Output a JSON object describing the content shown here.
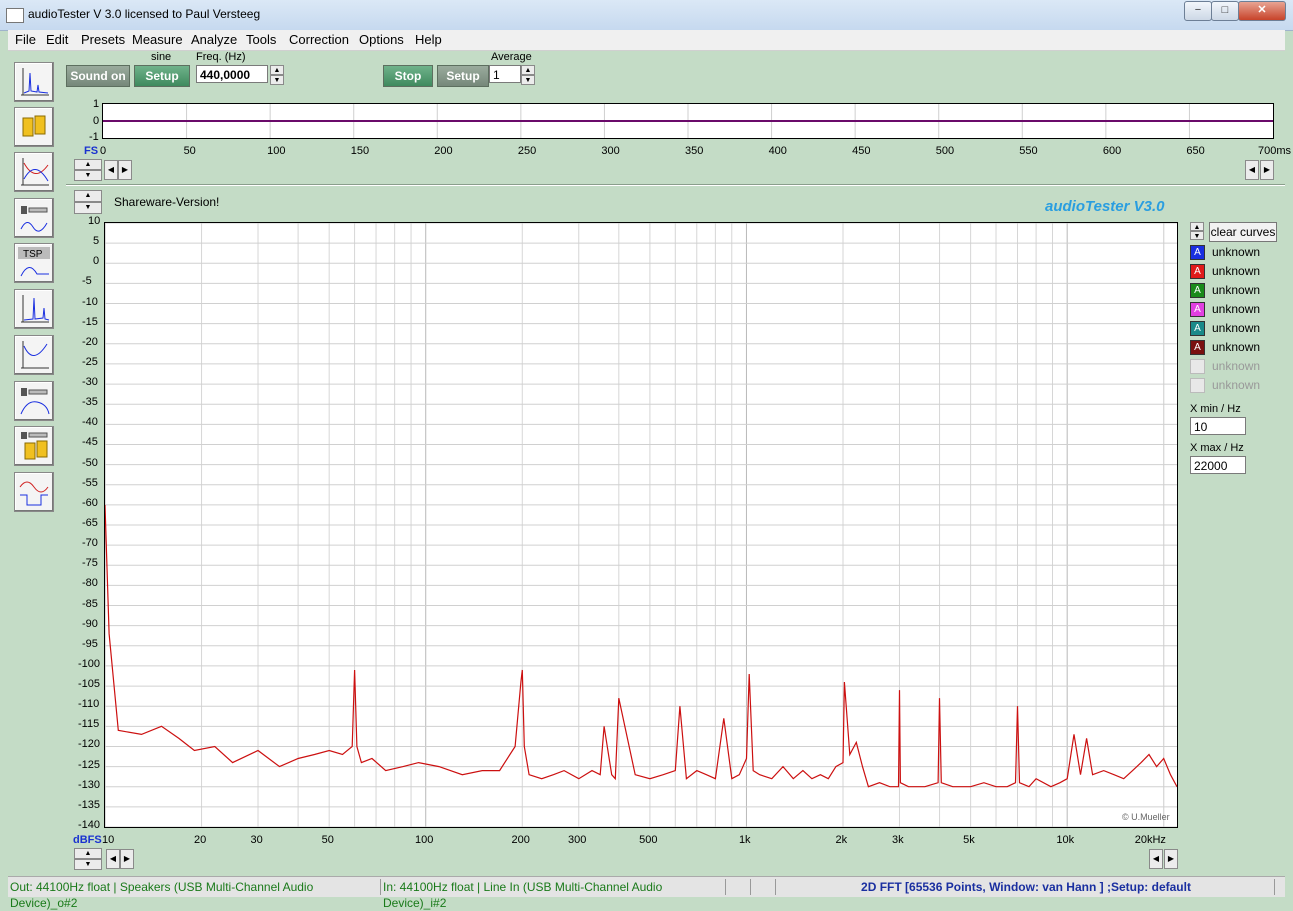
{
  "window": {
    "title": "audioTester  V 3.0   licensed to Paul Versteeg",
    "min": "−",
    "max": "□",
    "close": "✕"
  },
  "menu": [
    "File",
    "Edit",
    "Presets",
    "Measure",
    "Analyze",
    "Tools",
    "Correction",
    "Options",
    "Help"
  ],
  "generator": {
    "sound_on": "Sound on",
    "signal_type": "sine",
    "setup": "Setup",
    "freq_label": "Freq. (Hz)",
    "freq_value": "440,0000"
  },
  "capture": {
    "stop": "Stop",
    "setup": "Setup",
    "average_label": "Average",
    "average_value": "1"
  },
  "scope": {
    "y_ticks": [
      "1",
      "0",
      "-1"
    ],
    "fs_label": "FS",
    "x_ticks": [
      "0",
      "50",
      "100",
      "150",
      "200",
      "250",
      "300",
      "350",
      "400",
      "450",
      "500",
      "550",
      "600",
      "650",
      "700ms"
    ]
  },
  "shareware": "Shareware-Version!",
  "brand": "audioTester  V3.0",
  "copyright": "© U.Mueller",
  "spectrum": {
    "y_unit": "dBFS",
    "x_tick_labels": [
      "10",
      "20",
      "30",
      "50",
      "100",
      "200",
      "300",
      "500",
      "1k",
      "2k",
      "3k",
      "5k",
      "10k",
      "20kHz"
    ]
  },
  "legend": {
    "clear": "clear curves",
    "items": [
      {
        "label": "unknown",
        "color": "#1a2fe0",
        "active": true
      },
      {
        "label": "unknown",
        "color": "#e01a1a",
        "active": true
      },
      {
        "label": "unknown",
        "color": "#1a8a1a",
        "active": true
      },
      {
        "label": "unknown",
        "color": "#e040e0",
        "active": true
      },
      {
        "label": "unknown",
        "color": "#1a8a8a",
        "active": true
      },
      {
        "label": "unknown",
        "color": "#7a1010",
        "active": true
      },
      {
        "label": "unknown",
        "color": "#aaaaaa",
        "active": false
      },
      {
        "label": "unknown",
        "color": "#aaaaaa",
        "active": false
      }
    ],
    "xmin_label": "X min / Hz",
    "xmin_value": "10",
    "xmax_label": "X max / Hz",
    "xmax_value": "22000"
  },
  "status": {
    "out": "Out: 44100Hz float  | Speakers (USB Multi-Channel Audio Device)_o#2",
    "in": "In: 44100Hz float  | Line In (USB Multi-Channel Audio Device)_i#2",
    "info": "2D FFT [65536 Points, Window: van Hann ] ;Setup:  default"
  },
  "chart_data": {
    "type": "line",
    "title": "",
    "xlabel": "",
    "ylabel": "dBFS",
    "xscale": "log",
    "xlim": [
      10,
      22000
    ],
    "ylim": [
      -140,
      10
    ],
    "y_ticks": [
      10,
      5,
      0,
      -5,
      -10,
      -15,
      -20,
      -25,
      -30,
      -35,
      -40,
      -45,
      -50,
      -55,
      -60,
      -65,
      -70,
      -75,
      -80,
      -85,
      -90,
      -95,
      -100,
      -105,
      -110,
      -115,
      -120,
      -125,
      -130,
      -135,
      -140
    ],
    "grid": true,
    "series": [
      {
        "color": "#cc1010",
        "x": [
          10,
          10.3,
          11,
          13,
          15,
          17,
          19,
          22,
          25,
          30,
          35,
          40,
          45,
          50,
          55,
          59,
          60,
          61,
          63,
          68,
          75,
          85,
          95,
          110,
          130,
          150,
          170,
          190,
          198,
          200,
          203,
          210,
          230,
          250,
          270,
          300,
          330,
          350,
          360,
          380,
          390,
          400,
          450,
          500,
          550,
          600,
          620,
          650,
          700,
          750,
          800,
          850,
          900,
          950,
          1000,
          1020,
          1050,
          1100,
          1200,
          1300,
          1400,
          1500,
          1600,
          1700,
          1800,
          1900,
          2000,
          2020,
          2100,
          2200,
          2300,
          2400,
          2600,
          2800,
          2980,
          3000,
          3020,
          3200,
          3600,
          3960,
          4000,
          4050,
          4400,
          5000,
          5500,
          6000,
          6500,
          6900,
          7000,
          7100,
          7600,
          8000,
          8900,
          9500,
          10000,
          10500,
          11000,
          11500,
          12000,
          13000,
          14000,
          15000,
          16000,
          17000,
          18000,
          19000,
          20000,
          21000,
          22000
        ],
        "y": [
          -60,
          -92,
          -116,
          -117,
          -115,
          -118,
          -121,
          -120,
          -124,
          -121,
          -125,
          -123,
          -122,
          -121,
          -122,
          -120,
          -101,
          -120,
          -124,
          -123,
          -126,
          -125,
          -124,
          -125,
          -127,
          -126,
          -126,
          -120,
          -104,
          -101,
          -120,
          -127,
          -128,
          -127,
          -126,
          -128,
          -126,
          -127,
          -115,
          -127,
          -128,
          -108,
          -127,
          -128,
          -127,
          -126,
          -110,
          -128,
          -126,
          -127,
          -128,
          -113,
          -128,
          -127,
          -123,
          -102,
          -126,
          -127,
          -128,
          -125,
          -128,
          -126,
          -128,
          -127,
          -128,
          -125,
          -124,
          -104,
          -122,
          -119,
          -125,
          -130,
          -129,
          -130,
          -130,
          -106,
          -129,
          -130,
          -130,
          -129,
          -108,
          -129,
          -130,
          -130,
          -129,
          -130,
          -130,
          -129,
          -110,
          -129,
          -130,
          -128,
          -130,
          -129,
          -128,
          -117,
          -127,
          -118,
          -127,
          -126,
          -127,
          -128,
          -126,
          -124,
          -122,
          -125,
          -123,
          -127,
          -130
        ]
      }
    ]
  }
}
